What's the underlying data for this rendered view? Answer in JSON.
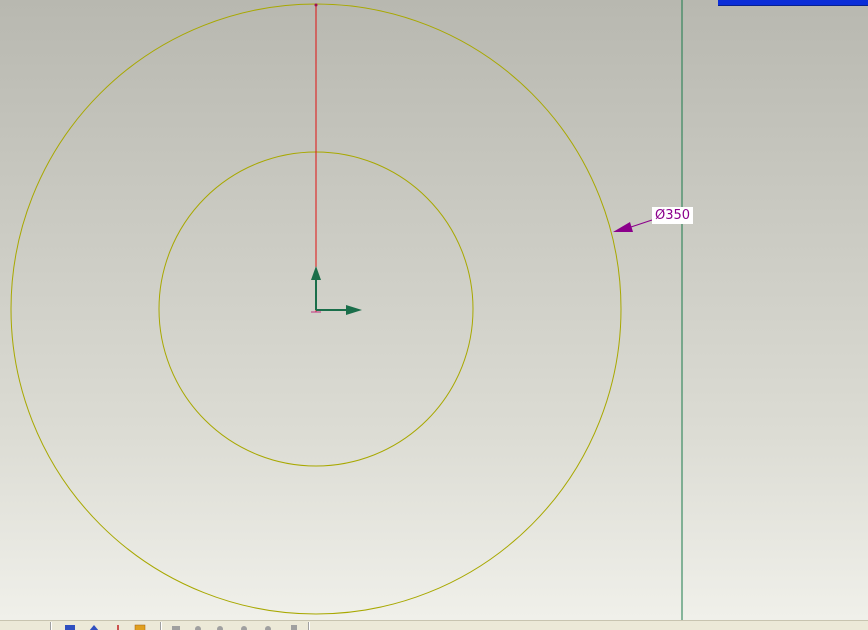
{
  "canvas": {
    "dimension": {
      "text": "Ø350",
      "color": "#8b008b"
    },
    "colors": {
      "circle": "#a8a800",
      "axis_line": "#e01010",
      "triad": "#1a7a4a",
      "vertical_line": "#1a7a4a",
      "title_bar": "#0a2dd8"
    }
  },
  "statusbar": {
    "icons": [
      "part-icon",
      "sketch-icon",
      "dimension-icon",
      "folder-icon",
      "grey-tool-icon",
      "grey-tool-icon",
      "grey-tool-icon",
      "grey-tool-icon",
      "grey-tool-icon"
    ]
  }
}
